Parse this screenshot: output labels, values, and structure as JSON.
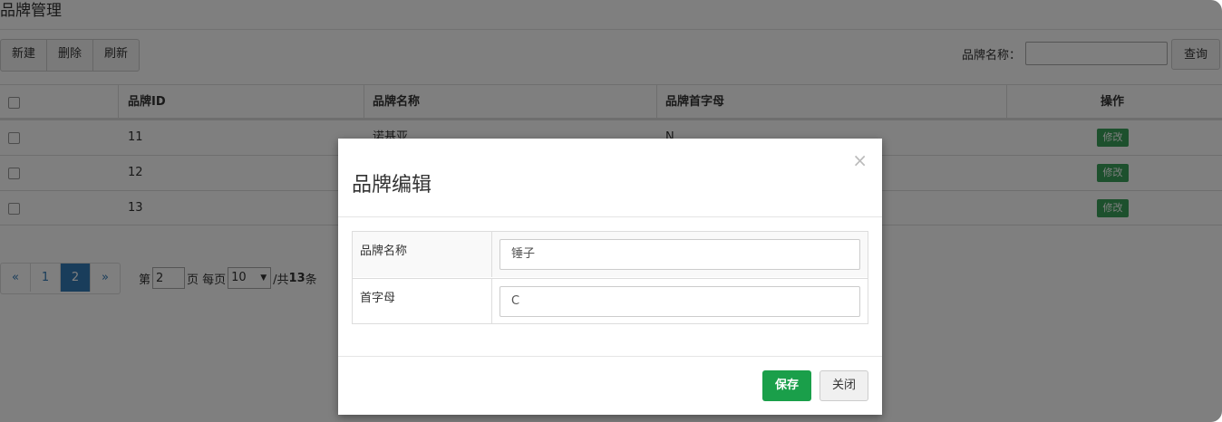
{
  "page": {
    "title": "品牌管理"
  },
  "toolbar": {
    "new_label": "新建",
    "delete_label": "删除",
    "refresh_label": "刷新"
  },
  "search": {
    "label": "品牌名称：",
    "value": "",
    "button_label": "查询"
  },
  "table": {
    "headers": [
      "品牌ID",
      "品牌名称",
      "品牌首字母",
      "操作"
    ],
    "rows": [
      {
        "id": "11",
        "name": "诺基亚",
        "letter": "N",
        "action": "修改"
      },
      {
        "id": "12",
        "name": "",
        "letter": "",
        "action": "修改"
      },
      {
        "id": "13",
        "name": "",
        "letter": "",
        "action": "修改"
      }
    ]
  },
  "pagination": {
    "prev": "«",
    "pages": [
      "1",
      "2"
    ],
    "current": "2",
    "next": "»",
    "page_prefix": "第",
    "page_input": "2",
    "page_suffix": "页 每页",
    "page_size": "10",
    "total_prefix": "/共",
    "total": "13",
    "total_suffix": "条"
  },
  "modal": {
    "title": "品牌编辑",
    "close_symbol": "×",
    "fields": [
      {
        "label": "品牌名称",
        "value": "锤子"
      },
      {
        "label": "首字母",
        "value": "C"
      }
    ],
    "save_label": "保存",
    "close_label": "关闭"
  }
}
